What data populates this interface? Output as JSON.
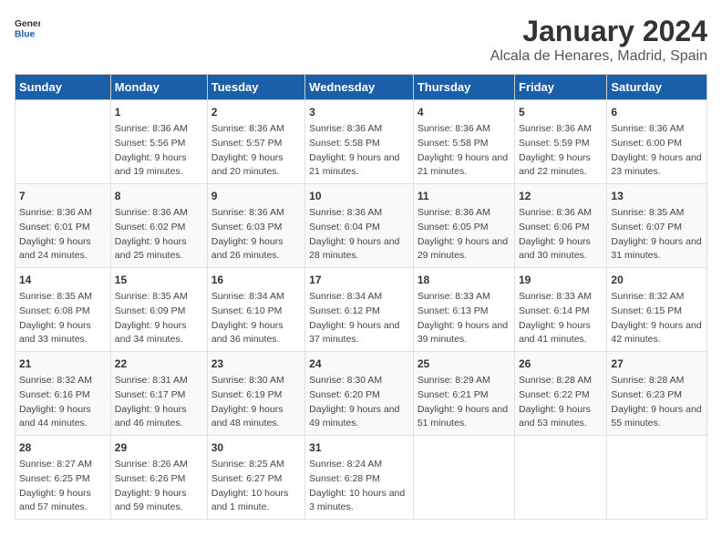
{
  "logo": {
    "text_general": "General",
    "text_blue": "Blue"
  },
  "header": {
    "title": "January 2024",
    "subtitle": "Alcala de Henares, Madrid, Spain"
  },
  "calendar": {
    "columns": [
      "Sunday",
      "Monday",
      "Tuesday",
      "Wednesday",
      "Thursday",
      "Friday",
      "Saturday"
    ],
    "weeks": [
      [
        {
          "day": "",
          "sunrise": "",
          "sunset": "",
          "daylight": ""
        },
        {
          "day": "1",
          "sunrise": "Sunrise: 8:36 AM",
          "sunset": "Sunset: 5:56 PM",
          "daylight": "Daylight: 9 hours and 19 minutes."
        },
        {
          "day": "2",
          "sunrise": "Sunrise: 8:36 AM",
          "sunset": "Sunset: 5:57 PM",
          "daylight": "Daylight: 9 hours and 20 minutes."
        },
        {
          "day": "3",
          "sunrise": "Sunrise: 8:36 AM",
          "sunset": "Sunset: 5:58 PM",
          "daylight": "Daylight: 9 hours and 21 minutes."
        },
        {
          "day": "4",
          "sunrise": "Sunrise: 8:36 AM",
          "sunset": "Sunset: 5:58 PM",
          "daylight": "Daylight: 9 hours and 21 minutes."
        },
        {
          "day": "5",
          "sunrise": "Sunrise: 8:36 AM",
          "sunset": "Sunset: 5:59 PM",
          "daylight": "Daylight: 9 hours and 22 minutes."
        },
        {
          "day": "6",
          "sunrise": "Sunrise: 8:36 AM",
          "sunset": "Sunset: 6:00 PM",
          "daylight": "Daylight: 9 hours and 23 minutes."
        }
      ],
      [
        {
          "day": "7",
          "sunrise": "Sunrise: 8:36 AM",
          "sunset": "Sunset: 6:01 PM",
          "daylight": "Daylight: 9 hours and 24 minutes."
        },
        {
          "day": "8",
          "sunrise": "Sunrise: 8:36 AM",
          "sunset": "Sunset: 6:02 PM",
          "daylight": "Daylight: 9 hours and 25 minutes."
        },
        {
          "day": "9",
          "sunrise": "Sunrise: 8:36 AM",
          "sunset": "Sunset: 6:03 PM",
          "daylight": "Daylight: 9 hours and 26 minutes."
        },
        {
          "day": "10",
          "sunrise": "Sunrise: 8:36 AM",
          "sunset": "Sunset: 6:04 PM",
          "daylight": "Daylight: 9 hours and 28 minutes."
        },
        {
          "day": "11",
          "sunrise": "Sunrise: 8:36 AM",
          "sunset": "Sunset: 6:05 PM",
          "daylight": "Daylight: 9 hours and 29 minutes."
        },
        {
          "day": "12",
          "sunrise": "Sunrise: 8:36 AM",
          "sunset": "Sunset: 6:06 PM",
          "daylight": "Daylight: 9 hours and 30 minutes."
        },
        {
          "day": "13",
          "sunrise": "Sunrise: 8:35 AM",
          "sunset": "Sunset: 6:07 PM",
          "daylight": "Daylight: 9 hours and 31 minutes."
        }
      ],
      [
        {
          "day": "14",
          "sunrise": "Sunrise: 8:35 AM",
          "sunset": "Sunset: 6:08 PM",
          "daylight": "Daylight: 9 hours and 33 minutes."
        },
        {
          "day": "15",
          "sunrise": "Sunrise: 8:35 AM",
          "sunset": "Sunset: 6:09 PM",
          "daylight": "Daylight: 9 hours and 34 minutes."
        },
        {
          "day": "16",
          "sunrise": "Sunrise: 8:34 AM",
          "sunset": "Sunset: 6:10 PM",
          "daylight": "Daylight: 9 hours and 36 minutes."
        },
        {
          "day": "17",
          "sunrise": "Sunrise: 8:34 AM",
          "sunset": "Sunset: 6:12 PM",
          "daylight": "Daylight: 9 hours and 37 minutes."
        },
        {
          "day": "18",
          "sunrise": "Sunrise: 8:33 AM",
          "sunset": "Sunset: 6:13 PM",
          "daylight": "Daylight: 9 hours and 39 minutes."
        },
        {
          "day": "19",
          "sunrise": "Sunrise: 8:33 AM",
          "sunset": "Sunset: 6:14 PM",
          "daylight": "Daylight: 9 hours and 41 minutes."
        },
        {
          "day": "20",
          "sunrise": "Sunrise: 8:32 AM",
          "sunset": "Sunset: 6:15 PM",
          "daylight": "Daylight: 9 hours and 42 minutes."
        }
      ],
      [
        {
          "day": "21",
          "sunrise": "Sunrise: 8:32 AM",
          "sunset": "Sunset: 6:16 PM",
          "daylight": "Daylight: 9 hours and 44 minutes."
        },
        {
          "day": "22",
          "sunrise": "Sunrise: 8:31 AM",
          "sunset": "Sunset: 6:17 PM",
          "daylight": "Daylight: 9 hours and 46 minutes."
        },
        {
          "day": "23",
          "sunrise": "Sunrise: 8:30 AM",
          "sunset": "Sunset: 6:19 PM",
          "daylight": "Daylight: 9 hours and 48 minutes."
        },
        {
          "day": "24",
          "sunrise": "Sunrise: 8:30 AM",
          "sunset": "Sunset: 6:20 PM",
          "daylight": "Daylight: 9 hours and 49 minutes."
        },
        {
          "day": "25",
          "sunrise": "Sunrise: 8:29 AM",
          "sunset": "Sunset: 6:21 PM",
          "daylight": "Daylight: 9 hours and 51 minutes."
        },
        {
          "day": "26",
          "sunrise": "Sunrise: 8:28 AM",
          "sunset": "Sunset: 6:22 PM",
          "daylight": "Daylight: 9 hours and 53 minutes."
        },
        {
          "day": "27",
          "sunrise": "Sunrise: 8:28 AM",
          "sunset": "Sunset: 6:23 PM",
          "daylight": "Daylight: 9 hours and 55 minutes."
        }
      ],
      [
        {
          "day": "28",
          "sunrise": "Sunrise: 8:27 AM",
          "sunset": "Sunset: 6:25 PM",
          "daylight": "Daylight: 9 hours and 57 minutes."
        },
        {
          "day": "29",
          "sunrise": "Sunrise: 8:26 AM",
          "sunset": "Sunset: 6:26 PM",
          "daylight": "Daylight: 9 hours and 59 minutes."
        },
        {
          "day": "30",
          "sunrise": "Sunrise: 8:25 AM",
          "sunset": "Sunset: 6:27 PM",
          "daylight": "Daylight: 10 hours and 1 minute."
        },
        {
          "day": "31",
          "sunrise": "Sunrise: 8:24 AM",
          "sunset": "Sunset: 6:28 PM",
          "daylight": "Daylight: 10 hours and 3 minutes."
        },
        {
          "day": "",
          "sunrise": "",
          "sunset": "",
          "daylight": ""
        },
        {
          "day": "",
          "sunrise": "",
          "sunset": "",
          "daylight": ""
        },
        {
          "day": "",
          "sunrise": "",
          "sunset": "",
          "daylight": ""
        }
      ]
    ]
  }
}
